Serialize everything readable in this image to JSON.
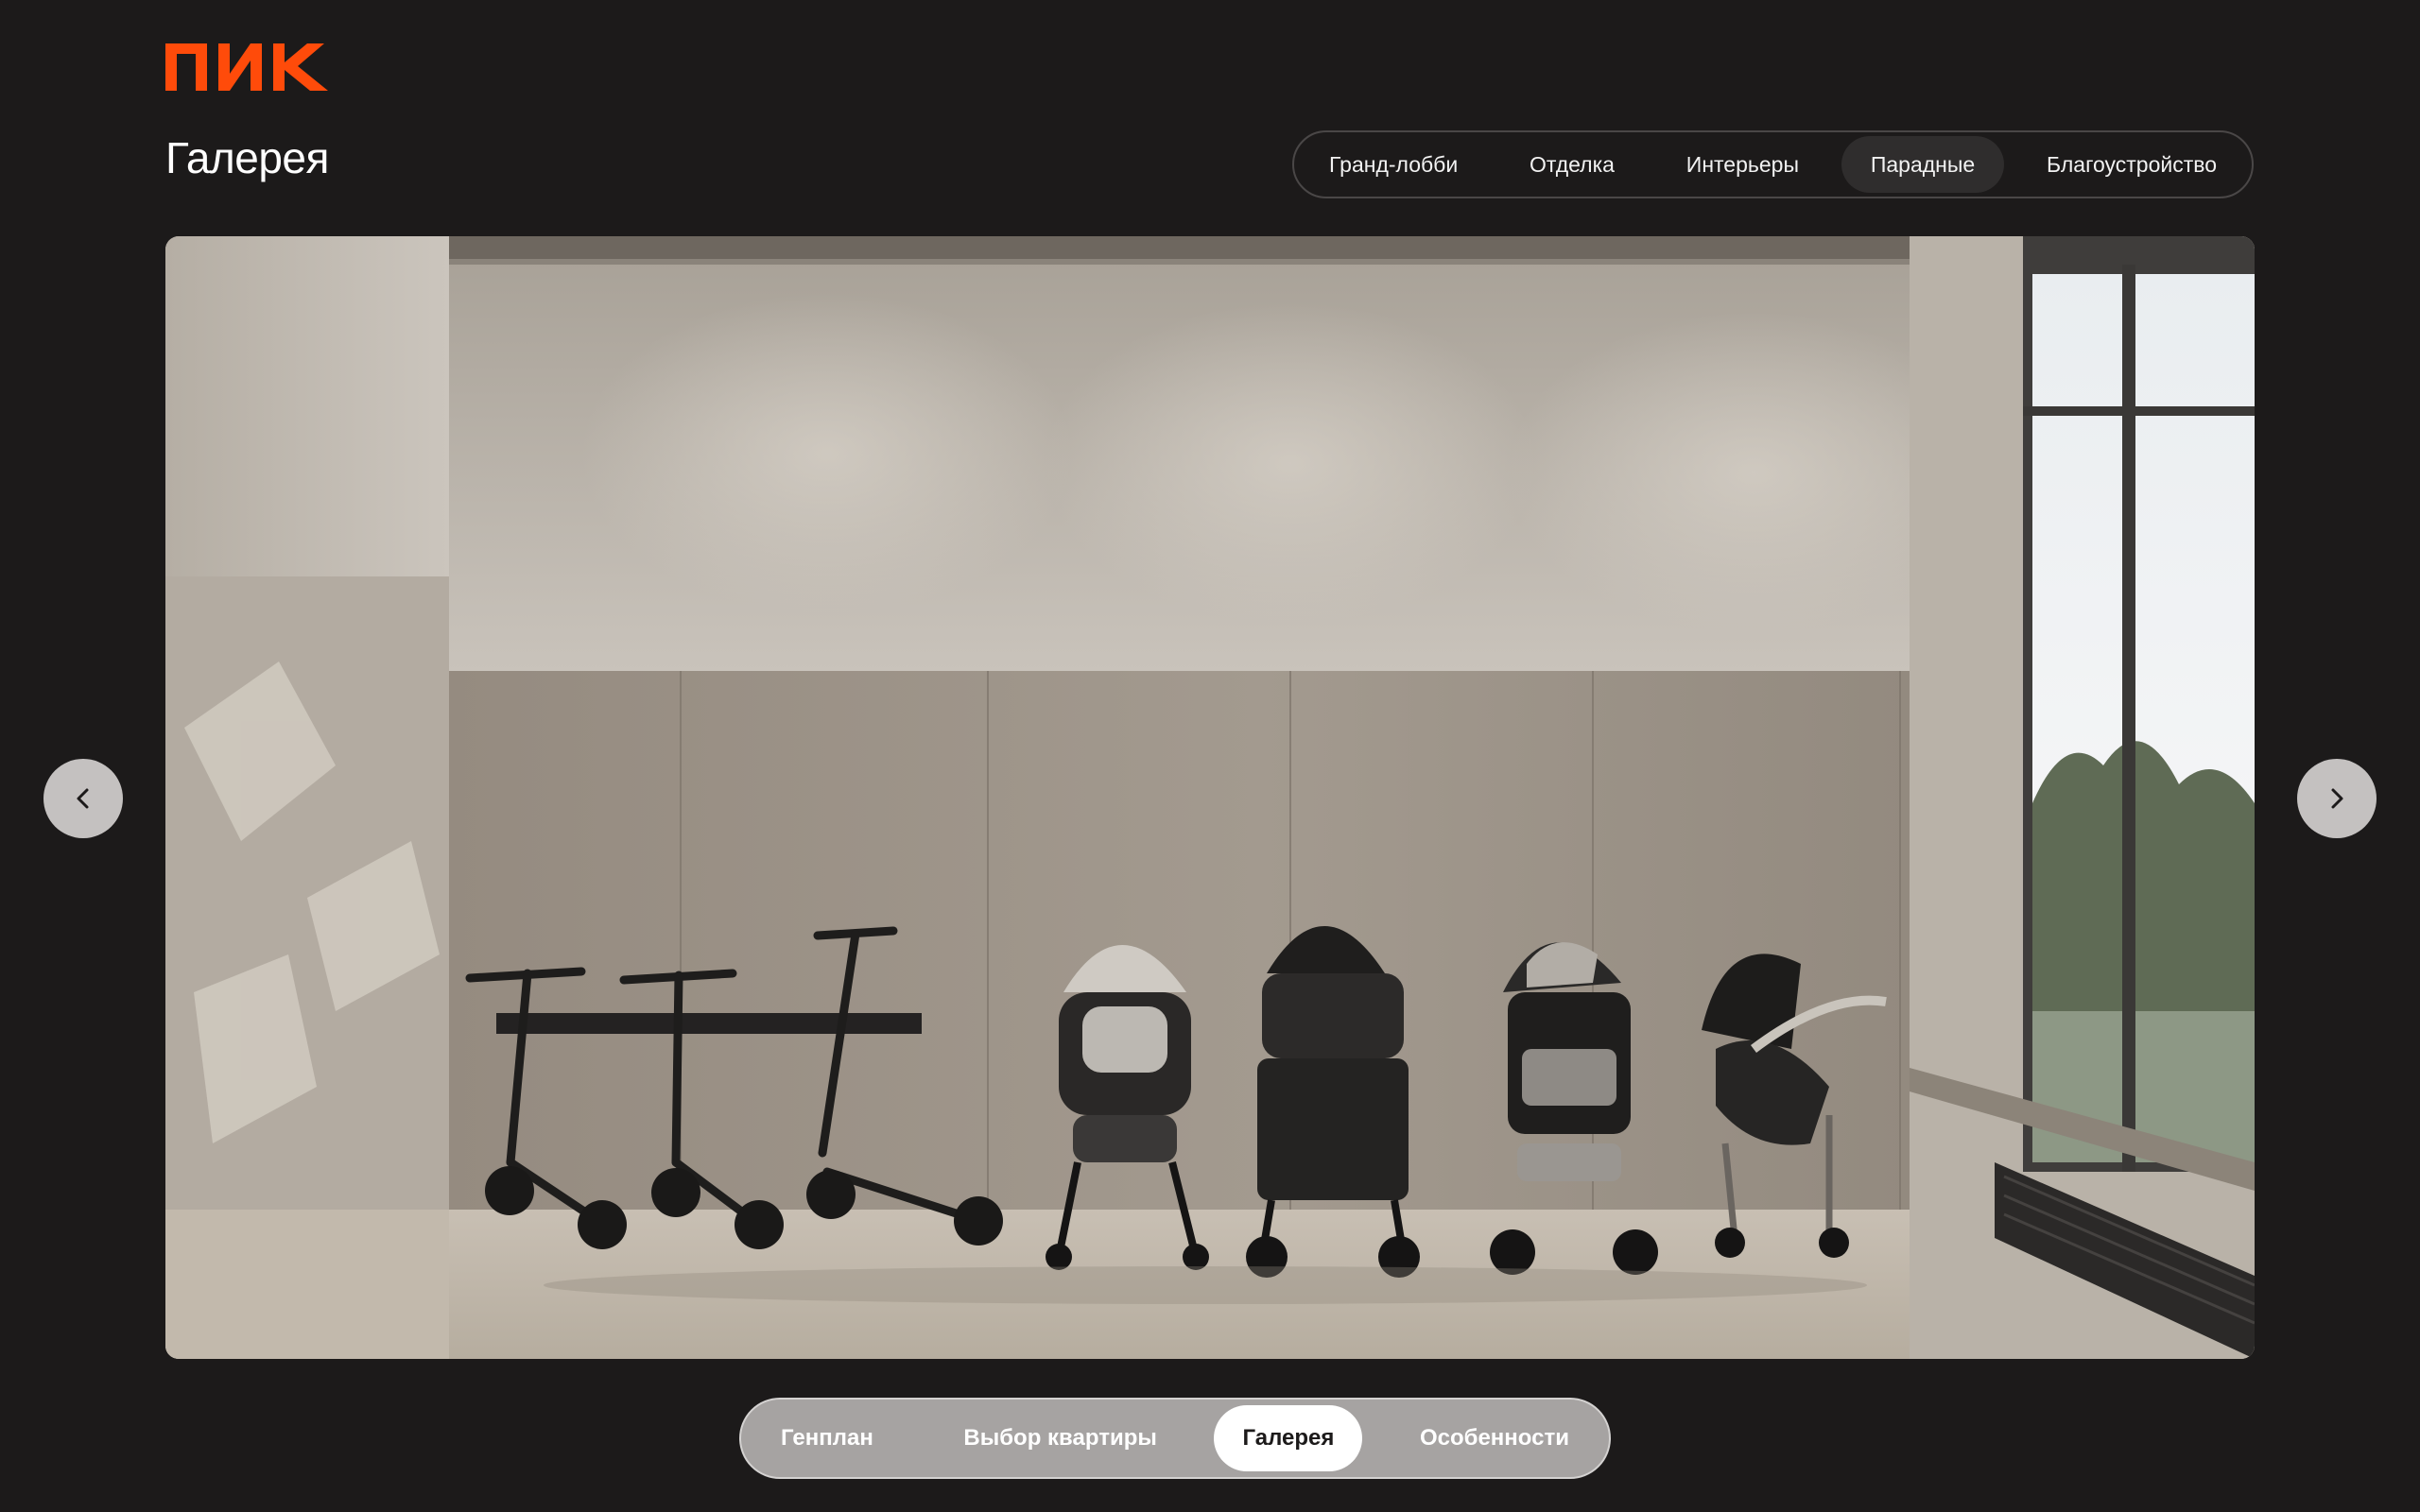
{
  "brand": {
    "logo_text": "ПИК",
    "accent_color": "#ff4b0a"
  },
  "page": {
    "title": "Галерея"
  },
  "category_tabs": [
    {
      "label": "Гранд-лобби",
      "active": false
    },
    {
      "label": "Отделка",
      "active": false
    },
    {
      "label": "Интерьеры",
      "active": false
    },
    {
      "label": "Парадные",
      "active": true
    },
    {
      "label": "Благоустройство",
      "active": false
    }
  ],
  "gallery": {
    "image_subject": "entrance-hall-stroller-storage",
    "prev_icon": "chevron-left-icon",
    "next_icon": "chevron-right-icon"
  },
  "bottom_nav": [
    {
      "label": "Генплан",
      "active": false
    },
    {
      "label": "Выбор квартиры",
      "active": false
    },
    {
      "label": "Галерея",
      "active": true
    },
    {
      "label": "Особенности",
      "active": false
    }
  ]
}
